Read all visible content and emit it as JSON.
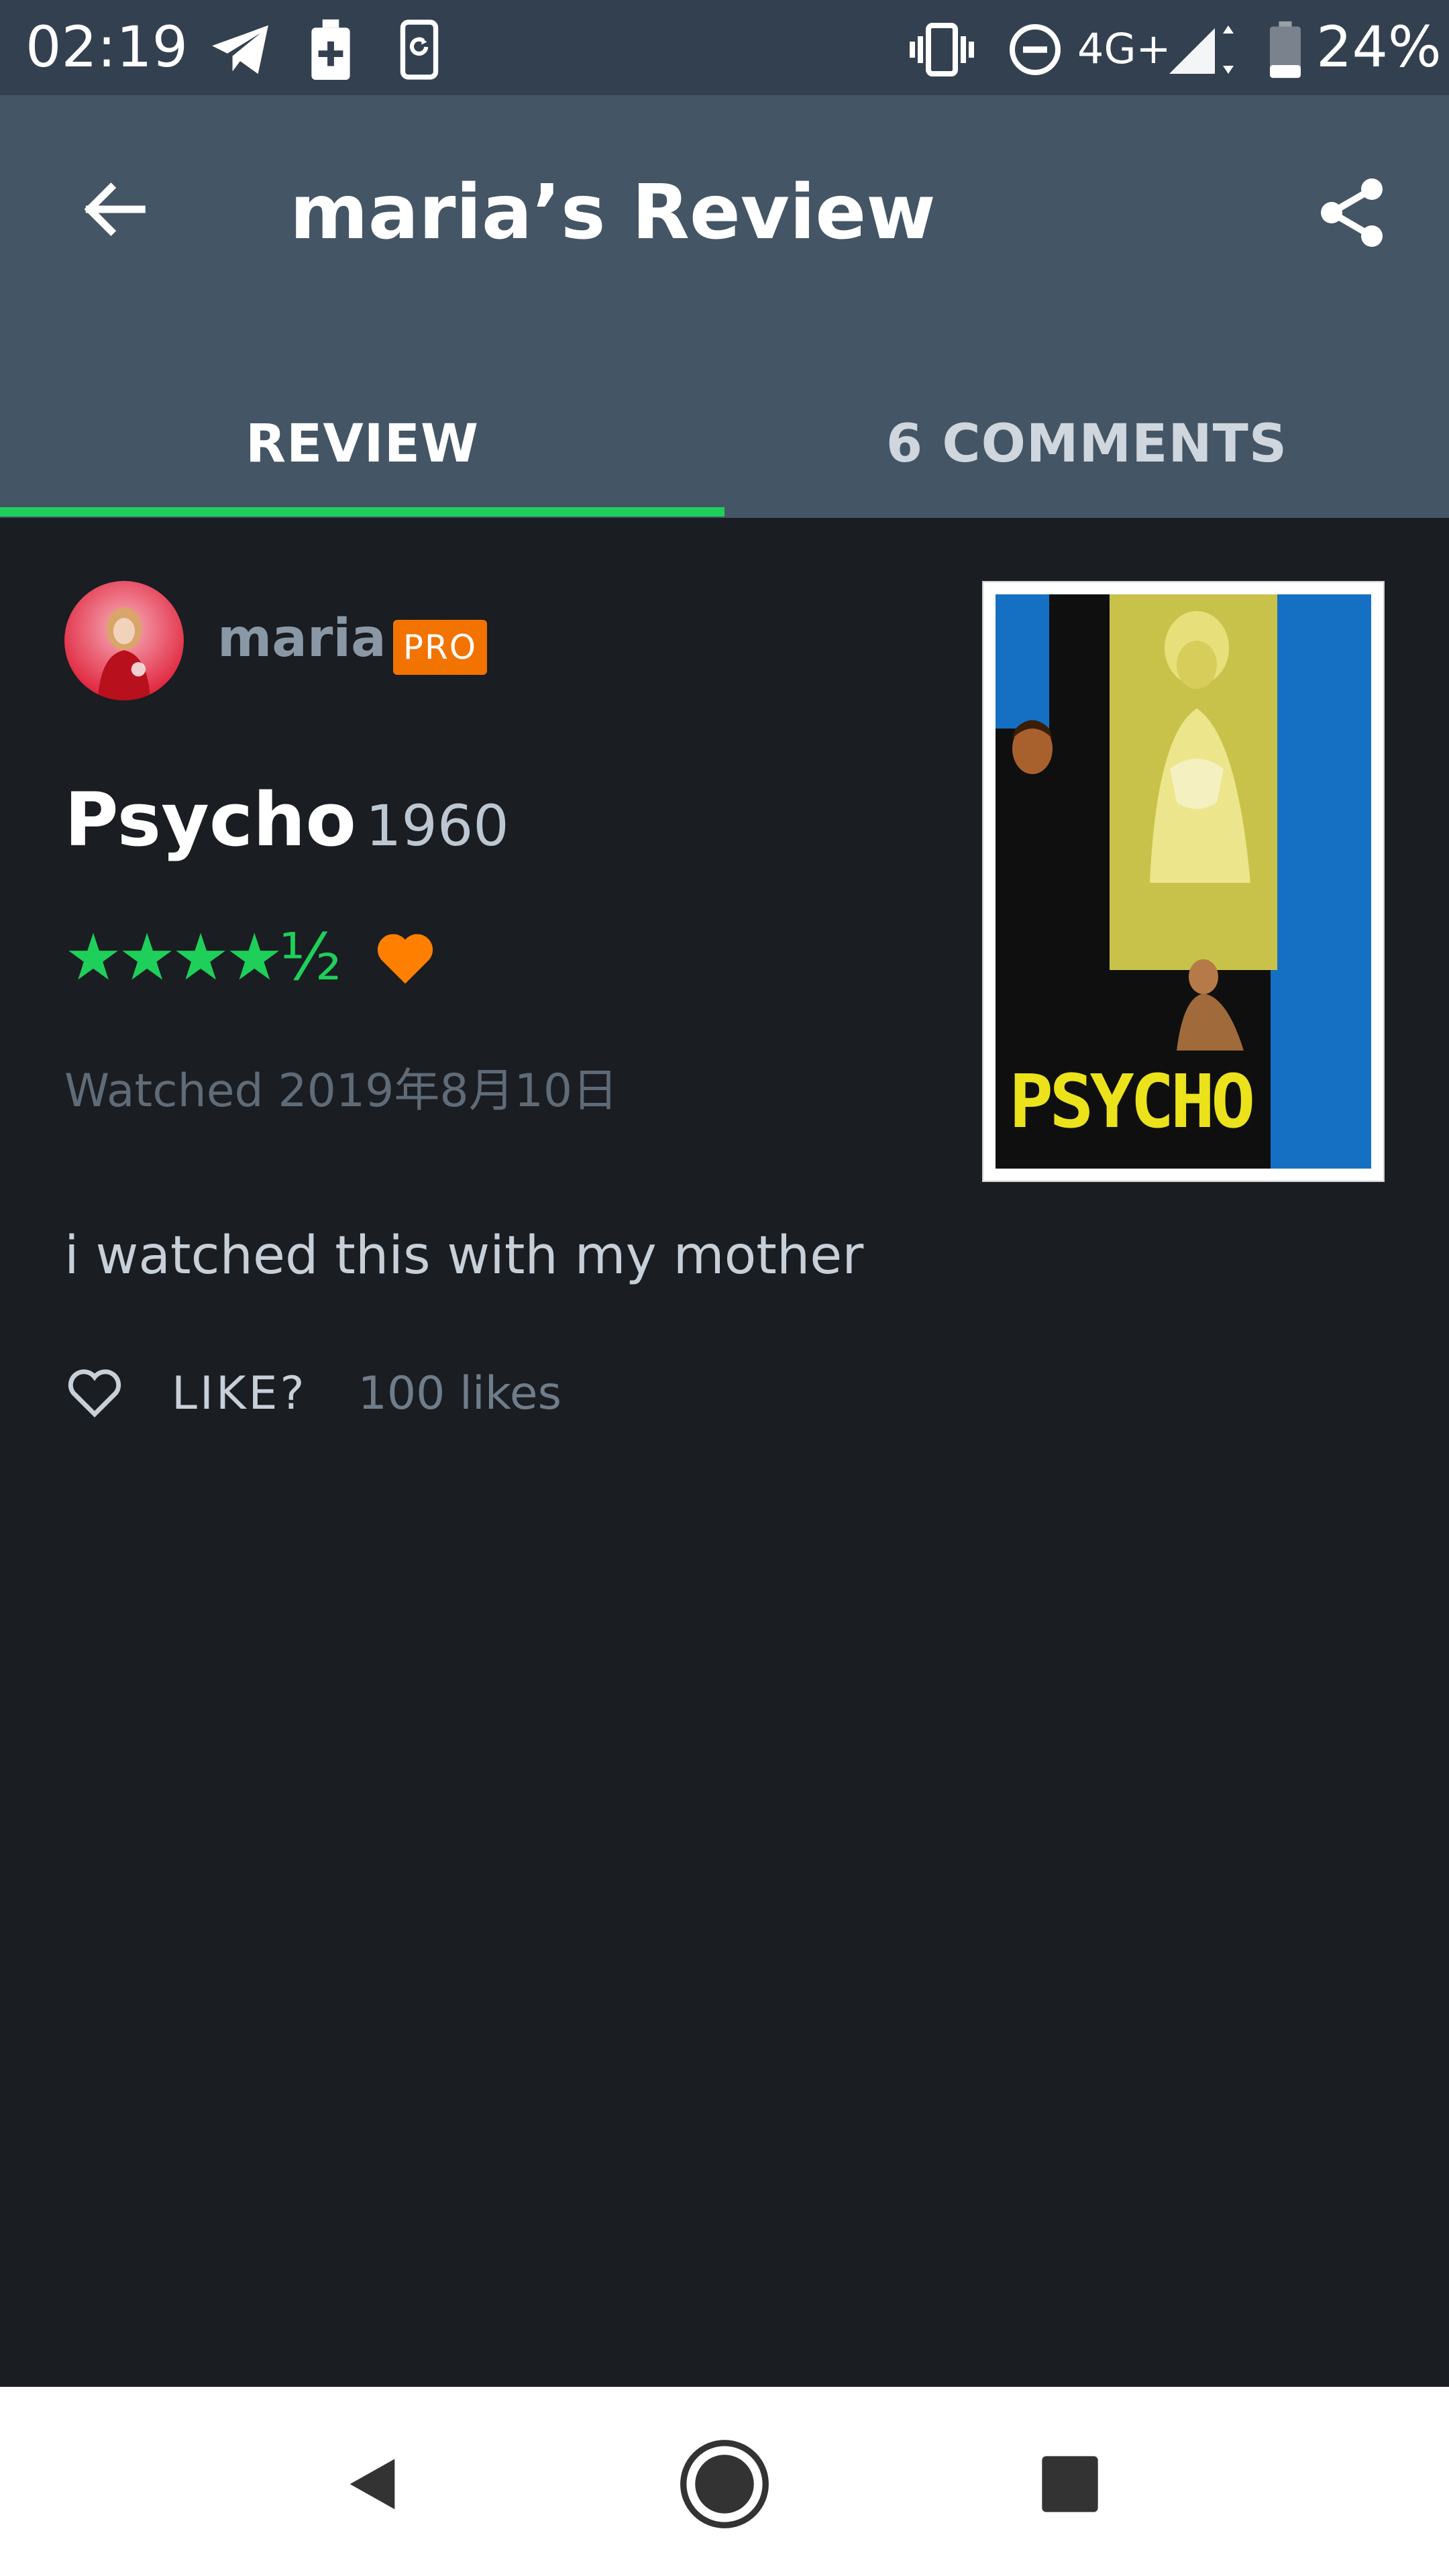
{
  "status_bar": {
    "time": "02:19",
    "network": "4G+",
    "battery_percent": "24%",
    "icons": [
      "telegram-icon",
      "battery-saver-icon",
      "screen-rotate-icon",
      "vibrate-icon",
      "do-not-disturb-icon",
      "signal-icon",
      "battery-icon"
    ]
  },
  "header": {
    "title": "maria’s Review",
    "back_icon": "arrow-left-icon",
    "share_icon": "share-icon"
  },
  "tabs": [
    {
      "label": "REVIEW",
      "active": true
    },
    {
      "label": "6 COMMENTS",
      "active": false
    }
  ],
  "review": {
    "username": "maria",
    "badge": "PRO",
    "film_title": "Psycho",
    "film_year": "1960",
    "rating": 4.5,
    "rating_display": "★★★★½",
    "liked": true,
    "watched_date": "Watched 2019年8月10日",
    "text": "i watched this with my mother",
    "like_label": "LIKE?",
    "likes_count": "100 likes"
  },
  "poster": {
    "title_text": "PSYCHO"
  },
  "colors": {
    "accent_green": "#1ed05a",
    "pro_orange": "#f27300",
    "heart_orange": "#ff8000",
    "app_bar": "#445565",
    "status_bar": "#334050",
    "background": "#1a1d22"
  },
  "nav_bar": {
    "icons": [
      "nav-back-icon",
      "nav-home-icon",
      "nav-recents-icon"
    ]
  }
}
